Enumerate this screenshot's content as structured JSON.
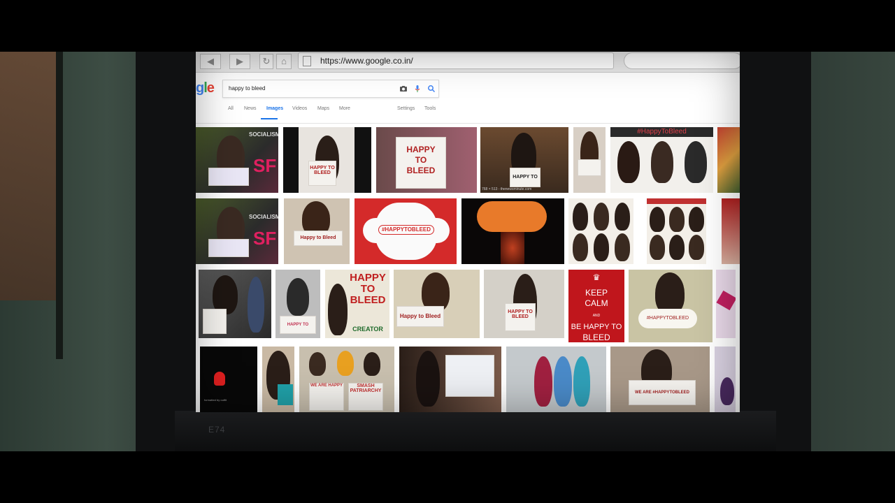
{
  "browser": {
    "back_icon": "◀",
    "forward_icon": "▶",
    "reload_icon": "↻",
    "home_icon": "⌂",
    "url": "https://www.google.co.in/"
  },
  "google": {
    "logo_partial": [
      "g",
      "l",
      "e"
    ],
    "query": "happy to bleed",
    "tabs": [
      {
        "label": "All"
      },
      {
        "label": "News"
      },
      {
        "label": "Images",
        "active": true
      },
      {
        "label": "Videos"
      },
      {
        "label": "Maps"
      },
      {
        "label": "More"
      },
      {
        "label": "Settings"
      },
      {
        "label": "Tools"
      }
    ]
  },
  "results": {
    "caption_dim": "768 × 513 - thenewsminute.com",
    "sign_happy_to_bleed": "HAPPY TO BLEED",
    "hashtag_banner": "#HappyToBleed",
    "pad_hashtag": "#HAPPYTOBLEED",
    "keep_calm": [
      "KEEP",
      "CALM",
      "AND",
      "BE HAPPY TO",
      "BLEED"
    ],
    "smash": "SMASH PATRIARCHY",
    "we_are_happy": "WE ARE HAPPY",
    "we_are_tag": "WE ARE #HAPPYTOBLEED",
    "creator": "CREATOR",
    "socialism": "SOCIALISM",
    "sf": "SF",
    "happy_to": "HAPPY TO",
    "bleed": "BLEED",
    "happy": "HAPPY",
    "to": "TO",
    "happy_script": "Happy to Bleed",
    "small_caption": "formatted by outfit"
  },
  "monitor": {
    "model": "E74"
  }
}
